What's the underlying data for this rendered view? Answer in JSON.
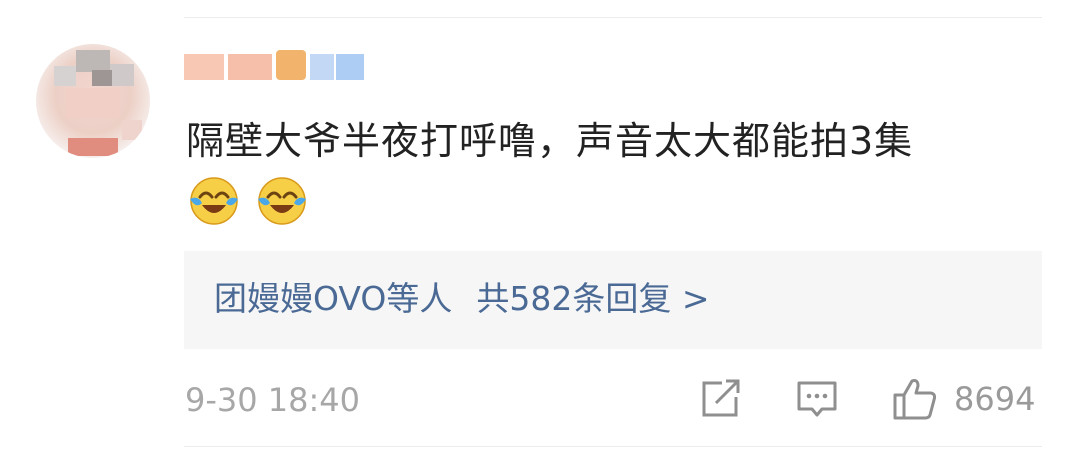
{
  "comment": {
    "text": "隔壁大爷半夜打呼噜，声音太大都能拍3集",
    "emojis": [
      "laugh-cry-icon",
      "laugh-cry-icon"
    ],
    "timestamp": "9-30 18:40",
    "like_count": "8694"
  },
  "replies": {
    "names": "团嫚嫚OVO等人",
    "count_label": "共582条回复 >"
  },
  "colors": {
    "text": "#222222",
    "link": "#4a6a95",
    "meta": "#a7a7a7",
    "reply_bg": "#f6f6f6"
  }
}
